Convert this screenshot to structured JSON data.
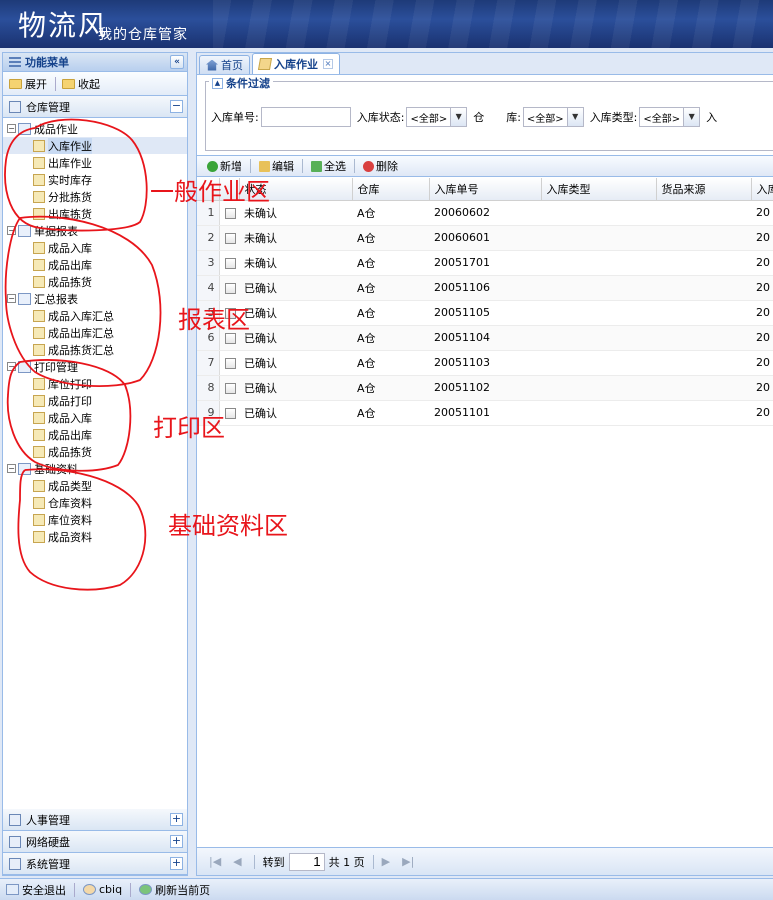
{
  "header": {
    "title_main": "物流风",
    "title_sub": "我的仓库管家"
  },
  "left": {
    "panel_title": "功能菜单",
    "collapse_symbol": "«",
    "toolbar": {
      "expand": "展开",
      "collapse": "收起"
    },
    "section_title": "仓库管理",
    "section_toggle": "−",
    "tree": [
      {
        "label": "成品作业",
        "level": 1,
        "exp": "−"
      },
      {
        "label": "入库作业",
        "level": 2,
        "selected": true
      },
      {
        "label": "出库作业",
        "level": 2
      },
      {
        "label": "实时库存",
        "level": 2
      },
      {
        "label": "分批拣货",
        "level": 2
      },
      {
        "label": "出库拣货",
        "level": 2
      },
      {
        "label": "单据报表",
        "level": 1,
        "exp": "−"
      },
      {
        "label": "成品入库",
        "level": 2
      },
      {
        "label": "成品出库",
        "level": 2
      },
      {
        "label": "成品拣货",
        "level": 2
      },
      {
        "label": "汇总报表",
        "level": 1,
        "exp": "−"
      },
      {
        "label": "成品入库汇总",
        "level": 2
      },
      {
        "label": "成品出库汇总",
        "level": 2
      },
      {
        "label": "成品拣货汇总",
        "level": 2
      },
      {
        "label": "打印管理",
        "level": 1,
        "exp": "−"
      },
      {
        "label": "库位打印",
        "level": 2
      },
      {
        "label": "成品打印",
        "level": 2
      },
      {
        "label": "成品入库",
        "level": 2
      },
      {
        "label": "成品出库",
        "level": 2
      },
      {
        "label": "成品拣货",
        "level": 2
      },
      {
        "label": "基础资料",
        "level": 1,
        "exp": "−"
      },
      {
        "label": "成品类型",
        "level": 2
      },
      {
        "label": "仓库资料",
        "level": 2
      },
      {
        "label": "库位资料",
        "level": 2
      },
      {
        "label": "成品资料",
        "level": 2
      }
    ],
    "bottom_sections": [
      {
        "label": "人事管理",
        "toggle": "+"
      },
      {
        "label": "网络硬盘",
        "toggle": "+"
      },
      {
        "label": "系统管理",
        "toggle": "+"
      }
    ]
  },
  "tabs": [
    {
      "label": "首页",
      "active": false
    },
    {
      "label": "入库作业",
      "active": true,
      "close": "×"
    }
  ],
  "filter": {
    "legend": "条件过滤",
    "collapse_symbol": "▲",
    "order_label": "入库单号:",
    "order_value": "",
    "status_label": "入库状态:",
    "status_value": "<全部>",
    "warehouse_label": "仓　　库:",
    "warehouse_value": "<全部>",
    "type_label": "入库类型:",
    "type_value": "<全部>",
    "extra_label": "入",
    "dropdown_arrow": "▼"
  },
  "grid_toolbar": {
    "add": "新增",
    "edit": "编辑",
    "select_all": "全选",
    "delete": "删除"
  },
  "grid": {
    "columns": [
      "",
      "",
      "状态",
      "仓库",
      "入库单号",
      "入库类型",
      "货品来源",
      "入库"
    ],
    "rows": [
      {
        "n": "1",
        "status": "未确认",
        "wh": "A仓",
        "no": "20060602",
        "type": "",
        "src": "",
        "date": "20"
      },
      {
        "n": "2",
        "status": "未确认",
        "wh": "A仓",
        "no": "20060601",
        "type": "",
        "src": "",
        "date": "20"
      },
      {
        "n": "3",
        "status": "未确认",
        "wh": "A仓",
        "no": "20051701",
        "type": "",
        "src": "",
        "date": "20"
      },
      {
        "n": "4",
        "status": "已确认",
        "wh": "A仓",
        "no": "20051106",
        "type": "",
        "src": "",
        "date": "20"
      },
      {
        "n": "5",
        "status": "已确认",
        "wh": "A仓",
        "no": "20051105",
        "type": "",
        "src": "",
        "date": "20"
      },
      {
        "n": "6",
        "status": "已确认",
        "wh": "A仓",
        "no": "20051104",
        "type": "",
        "src": "",
        "date": "20"
      },
      {
        "n": "7",
        "status": "已确认",
        "wh": "A仓",
        "no": "20051103",
        "type": "",
        "src": "",
        "date": "20"
      },
      {
        "n": "8",
        "status": "已确认",
        "wh": "A仓",
        "no": "20051102",
        "type": "",
        "src": "",
        "date": "20"
      },
      {
        "n": "9",
        "status": "已确认",
        "wh": "A仓",
        "no": "20051101",
        "type": "",
        "src": "",
        "date": "20"
      }
    ]
  },
  "pager": {
    "first": "|◀",
    "prev": "◀",
    "goto": "转到",
    "page": "1",
    "total": "共 1 页",
    "next": "▶",
    "last": "▶|"
  },
  "status_bar": {
    "logout": "安全退出",
    "user": "cbiq",
    "refresh": "刷新当前页"
  },
  "annotations": {
    "labels": [
      "一般作业区",
      "报表区",
      "打印区",
      "基础资料区"
    ],
    "color": "#e8151b"
  }
}
